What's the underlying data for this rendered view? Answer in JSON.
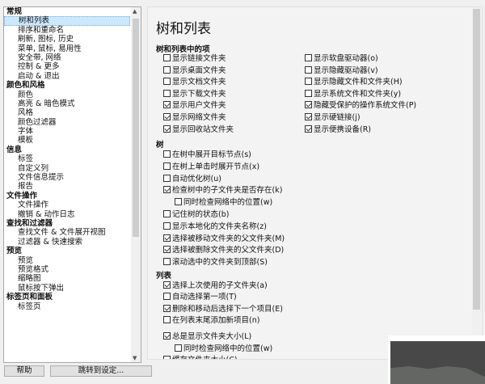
{
  "sidebar": {
    "groups": [
      {
        "label": "常规",
        "items": [
          "树和列表",
          "排序和重命名",
          "刷新, 图标, 历史",
          "菜单, 鼠标, 易用性",
          "安全带, 网络",
          "控制 & 更多",
          "启动 & 退出"
        ]
      },
      {
        "label": "颜色和风格",
        "items": [
          "颜色",
          "高亮 & 暗色模式",
          "风格",
          "颜色过滤器",
          "字体",
          "模板"
        ]
      },
      {
        "label": "信息",
        "items": [
          "标签",
          "自定义列",
          "文件信息提示",
          "报告"
        ]
      },
      {
        "label": "文件操作",
        "items": [
          "文件操作",
          "撤销 & 动作日志"
        ]
      },
      {
        "label": "查找和过滤器",
        "items": [
          "查找文件 & 文件展开视图",
          "过滤器 & 快速搜索"
        ]
      },
      {
        "label": "预览",
        "items": [
          "预览",
          "预览格式",
          "缩略图",
          "鼠标按下弹出"
        ]
      },
      {
        "label": "标签页和面板",
        "items": [
          "标签页"
        ]
      }
    ],
    "selected": "树和列表"
  },
  "buttons": {
    "help": "帮助",
    "goto": "跳转到设定..."
  },
  "panel": {
    "title": "树和列表",
    "sec1": {
      "label": "树和列表中的项",
      "left": [
        {
          "t": "显示链接文件夹",
          "c": false
        },
        {
          "t": "显示桌面文件夹",
          "c": false
        },
        {
          "t": "显示文档文件夹",
          "c": false
        },
        {
          "t": "显示下载文件夹",
          "c": false
        },
        {
          "t": "显示用户文件夹",
          "c": true
        },
        {
          "t": "显示网络文件夹",
          "c": true
        },
        {
          "t": "显示回收站文件夹",
          "c": true
        }
      ],
      "right": [
        {
          "t": "显示软盘驱动器(o)",
          "c": false
        },
        {
          "t": "显示隐藏驱动器(v)",
          "c": false
        },
        {
          "t": "显示隐藏文件和文件夹(H)",
          "c": false
        },
        {
          "t": "显示系统文件和文件夹(y)",
          "c": false
        },
        {
          "t": "隐藏受保护的操作系统文件(P)",
          "c": true
        },
        {
          "t": "显示硬链接(j)",
          "c": true
        },
        {
          "t": "显示便携设备(R)",
          "c": true
        }
      ]
    },
    "sec2": {
      "label": "树",
      "items": [
        {
          "t": "在树中展开目标节点(s)",
          "c": false
        },
        {
          "t": "在树上单击时展开节点(x)",
          "c": false
        },
        {
          "t": "自动优化树(u)",
          "c": false
        },
        {
          "t": "检查树中的子文件夹是否存在(k)",
          "c": true
        },
        {
          "t": "同时检查网络中的位置(w)",
          "c": false,
          "indent": true
        },
        {
          "t": "记住树的状态(b)",
          "c": false
        },
        {
          "t": "显示本地化的文件夹名称(z)",
          "c": false
        },
        {
          "t": "选择被移动文件夹的父文件夹(M)",
          "c": true
        },
        {
          "t": "选择被删除文件夹的父文件夹(D)",
          "c": true
        },
        {
          "t": "滚动选中的文件夹到顶部(S)",
          "c": false
        }
      ]
    },
    "sec3": {
      "label": "列表",
      "items": [
        {
          "t": "选择上次使用的子文件夹(a)",
          "c": true
        },
        {
          "t": "自动选择第一项(T)",
          "c": false
        },
        {
          "t": "删除和移动后选择下一个项目(E)",
          "c": true
        },
        {
          "t": "在列表末尾添加新项目(n)",
          "c": false
        },
        {
          "t": "总是显示文件夹大小(L)",
          "c": true,
          "gap": true
        },
        {
          "t": "同时检查网络中的位置(w)",
          "c": false,
          "indent": true
        },
        {
          "t": "缓存文件夹大小(C)",
          "c": false
        }
      ]
    }
  }
}
